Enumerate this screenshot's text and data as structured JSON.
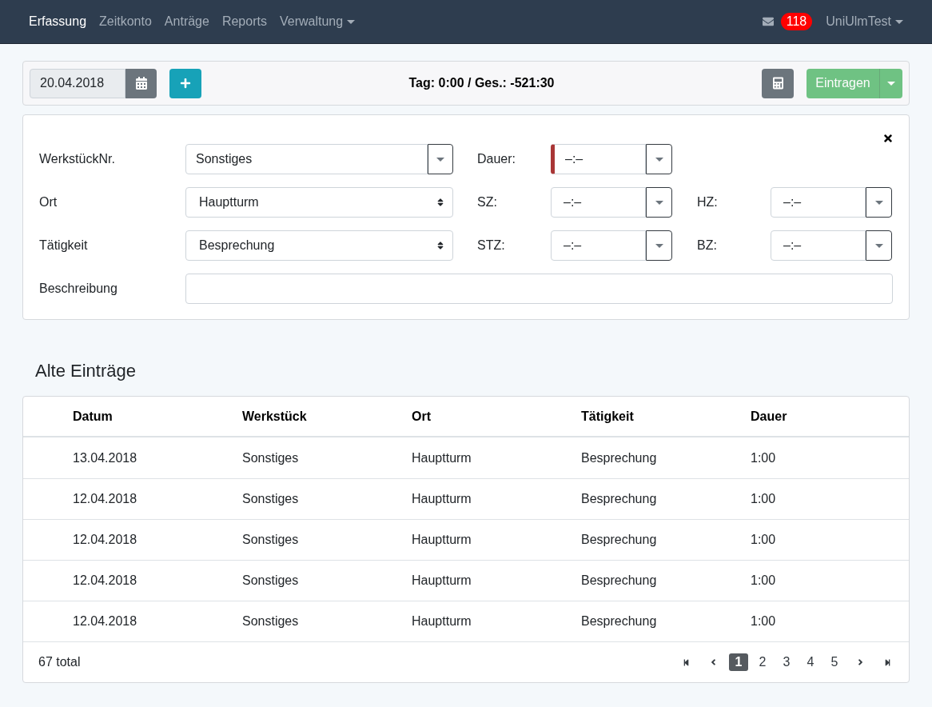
{
  "navbar": {
    "items": [
      {
        "label": "Erfassung",
        "kind": "link",
        "selected": true
      },
      {
        "label": "Zeitkonto",
        "kind": "link",
        "selected": false
      },
      {
        "label": "Anträge",
        "kind": "link",
        "selected": false
      },
      {
        "label": "Reports",
        "kind": "link",
        "selected": false
      },
      {
        "label": "Verwaltung",
        "kind": "dropdown",
        "selected": false
      }
    ],
    "messages_badge": "118",
    "user": "UniUlmTest"
  },
  "toolbar": {
    "date": "20.04.2018",
    "summary": "Tag: 0:00 / Ges.: -521:30",
    "submit": {
      "label": "Eintragen",
      "disabled": true
    }
  },
  "form": {
    "rows": [
      {
        "label": "WerkstückNr.",
        "field": {
          "kind": "combobox",
          "value": "Sonstiges"
        },
        "times": [
          {
            "label": "Dauer:",
            "value": "–:–",
            "invalid": true
          }
        ]
      },
      {
        "label": "Ort",
        "field": {
          "kind": "select",
          "value": "Hauptturm"
        },
        "times": [
          {
            "label": "SZ:",
            "value": "–:–",
            "invalid": false
          },
          {
            "label": "HZ:",
            "value": "–:–",
            "invalid": false
          }
        ]
      },
      {
        "label": "Tätigkeit",
        "field": {
          "kind": "select",
          "value": "Besprechung"
        },
        "times": [
          {
            "label": "STZ:",
            "value": "–:–",
            "invalid": false
          },
          {
            "label": "BZ:",
            "value": "–:–",
            "invalid": false
          }
        ]
      },
      {
        "label": "Beschreibung",
        "field": {
          "kind": "text"
        }
      }
    ]
  },
  "entries": {
    "title": "Alte Einträge",
    "table": {
      "columns": [
        "Datum",
        "Werkstück",
        "Ort",
        "Tätigkeit",
        "Dauer"
      ],
      "rows": [
        [
          "13.04.2018",
          "Sonstiges",
          "Hauptturm",
          "Besprechung",
          "1:00"
        ],
        [
          "12.04.2018",
          "Sonstiges",
          "Hauptturm",
          "Besprechung",
          "1:00"
        ],
        [
          "12.04.2018",
          "Sonstiges",
          "Hauptturm",
          "Besprechung",
          "1:00"
        ],
        [
          "12.04.2018",
          "Sonstiges",
          "Hauptturm",
          "Besprechung",
          "1:00"
        ],
        [
          "12.04.2018",
          "Sonstiges",
          "Hauptturm",
          "Besprechung",
          "1:00"
        ]
      ]
    },
    "total": "67 total",
    "pages": [
      {
        "label": "1",
        "selected": true
      },
      {
        "label": "2",
        "selected": false
      },
      {
        "label": "3",
        "selected": false
      },
      {
        "label": "4",
        "selected": false
      },
      {
        "label": "5",
        "selected": false
      }
    ]
  }
}
